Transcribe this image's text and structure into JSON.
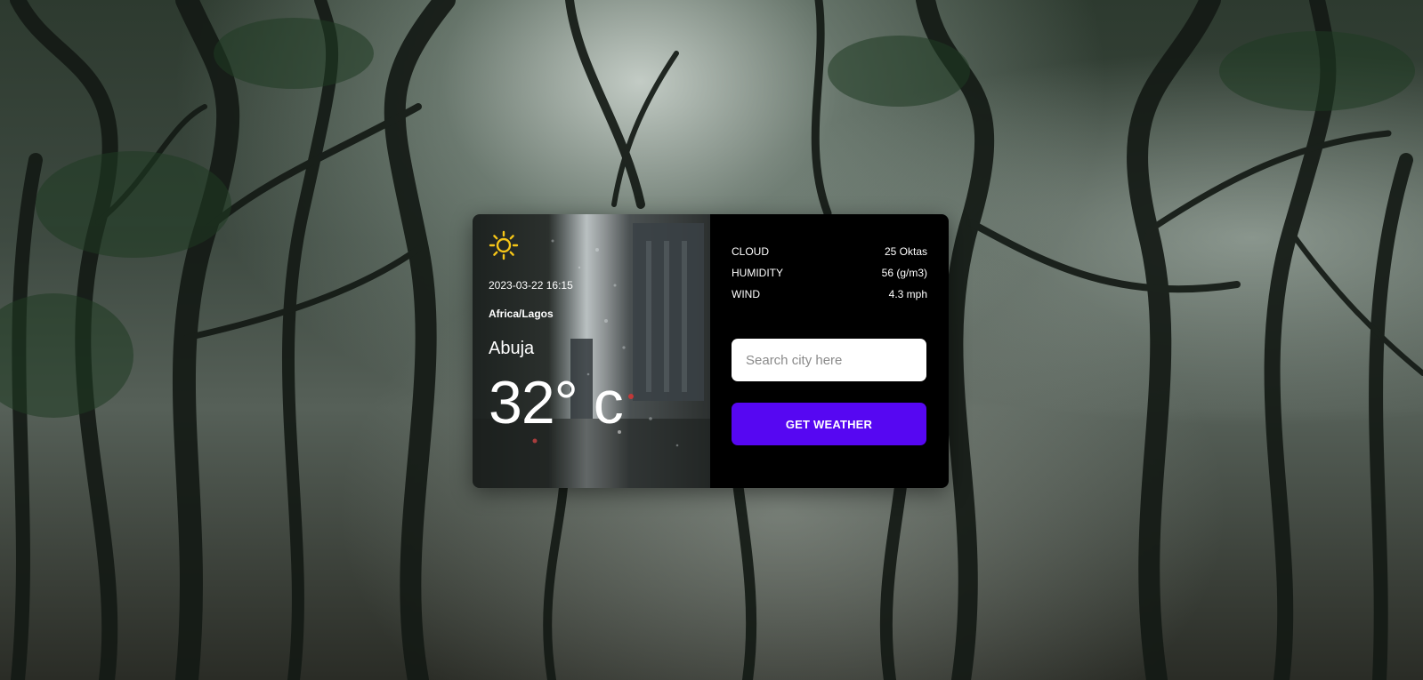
{
  "weather": {
    "icon": "sun-icon",
    "datetime": "2023-03-22 16:15",
    "timezone": "Africa/Lagos",
    "city": "Abuja",
    "temperature": "32° c"
  },
  "stats": [
    {
      "label": "CLOUD",
      "value": "25 Oktas"
    },
    {
      "label": "HUMIDITY",
      "value": "56 (g/m3)"
    },
    {
      "label": "WIND",
      "value": "4.3 mph"
    }
  ],
  "search": {
    "placeholder": "Search city here",
    "value": ""
  },
  "button": {
    "label": "GET WEATHER"
  },
  "colors": {
    "accent": "#5607f2",
    "sun": "#f5c518",
    "panel": "#000000"
  }
}
